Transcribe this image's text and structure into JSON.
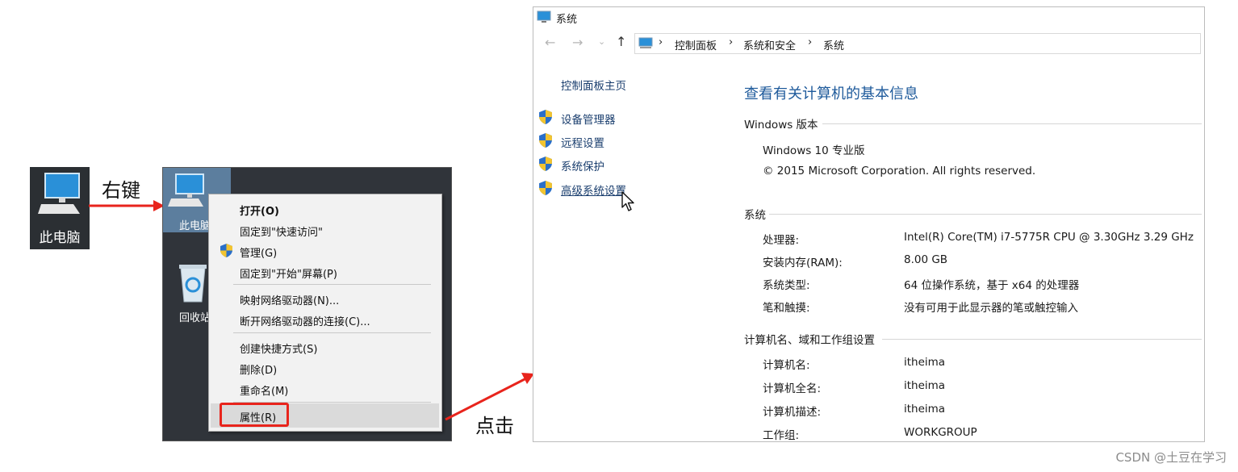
{
  "desktop_icon": {
    "label": "此电脑"
  },
  "callouts": {
    "right_click": "右键",
    "click": "点击"
  },
  "desktop": {
    "icon_this_pc_label": "此电脑",
    "icon_recycle_label": "回收站"
  },
  "context_menu": {
    "items": [
      {
        "label": "打开(O)"
      },
      {
        "label": "固定到\"快速访问\""
      },
      {
        "label": "管理(G)"
      },
      {
        "label": "固定到\"开始\"屏幕(P)"
      },
      {
        "label": "映射网络驱动器(N)..."
      },
      {
        "label": "断开网络驱动器的连接(C)..."
      },
      {
        "label": "创建快捷方式(S)"
      },
      {
        "label": "删除(D)"
      },
      {
        "label": "重命名(M)"
      },
      {
        "label": "属性(R)"
      }
    ]
  },
  "window": {
    "title": "系统",
    "breadcrumb": [
      "控制面板",
      "系统和安全",
      "系统"
    ],
    "sidebar": {
      "home": "控制面板主页",
      "links": [
        "设备管理器",
        "远程设置",
        "系统保护",
        "高级系统设置"
      ]
    },
    "heading": "查看有关计算机的基本信息",
    "edition": {
      "title": "Windows 版本",
      "name": "Windows 10 专业版",
      "copyright": "© 2015 Microsoft Corporation. All rights reserved."
    },
    "system": {
      "title": "系统",
      "rows": [
        {
          "label": "处理器:",
          "value": "Intel(R) Core(TM) i7-5775R CPU @ 3.30GHz   3.29 GHz"
        },
        {
          "label": "安装内存(RAM):",
          "value": "8.00 GB"
        },
        {
          "label": "系统类型:",
          "value": "64 位操作系统，基于 x64 的处理器"
        },
        {
          "label": "笔和触摸:",
          "value": "没有可用于此显示器的笔或触控输入"
        }
      ]
    },
    "computer": {
      "title": "计算机名、域和工作组设置",
      "rows": [
        {
          "label": "计算机名:",
          "value": "itheima"
        },
        {
          "label": "计算机全名:",
          "value": "itheima"
        },
        {
          "label": "计算机描述:",
          "value": "itheima"
        },
        {
          "label": "工作组:",
          "value": "WORKGROUP"
        }
      ]
    }
  },
  "watermark": "CSDN @土豆在学习",
  "colors": {
    "arrow": "#e8241c",
    "link": "#1a3e6e",
    "heading": "#1e5a9b"
  }
}
